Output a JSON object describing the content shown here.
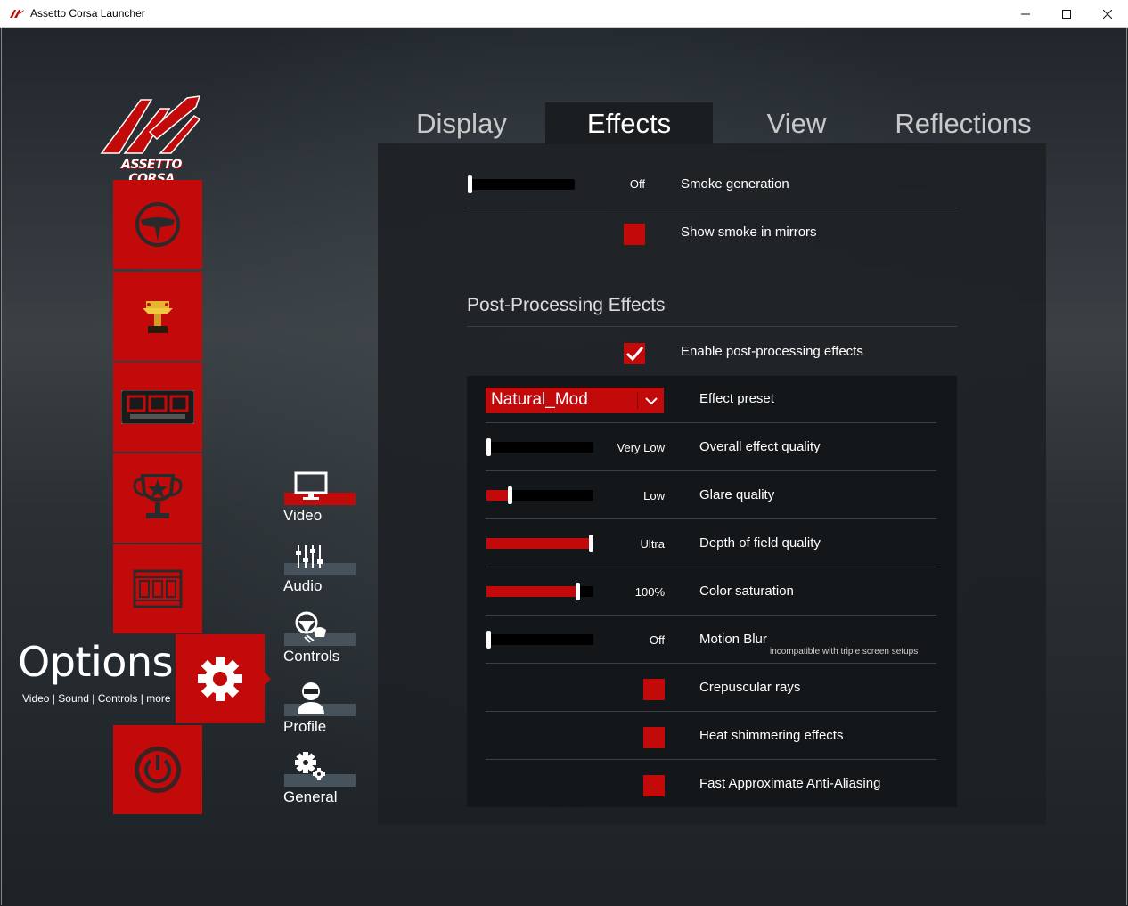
{
  "window": {
    "title": "Assetto Corsa Launcher",
    "minimize": "—",
    "maximize": "☐",
    "close": "✕"
  },
  "logo": {
    "text": "ASSETTO CORSA"
  },
  "main_menu": {
    "items": [
      "steering-wheel-icon",
      "trophy-car-icon",
      "srs-logo-icon",
      "championship-trophy-icon",
      "film-reel-icon",
      "gear-icon",
      "power-icon"
    ],
    "options_title": "Options",
    "options_subtitle": "Video | Sound | Controls | more"
  },
  "sub_menu": {
    "items": [
      {
        "label": "Video",
        "icon": "monitor-icon",
        "active": true
      },
      {
        "label": "Audio",
        "icon": "mixer-icon",
        "active": false
      },
      {
        "label": "Controls",
        "icon": "controls-icon",
        "active": false
      },
      {
        "label": "Profile",
        "icon": "driver-icon",
        "active": false
      },
      {
        "label": "General",
        "icon": "gears-icon",
        "active": false
      }
    ]
  },
  "tabs": [
    {
      "label": "Display",
      "active": false
    },
    {
      "label": "Effects",
      "active": true
    },
    {
      "label": "View",
      "active": false
    },
    {
      "label": "Reflections",
      "active": false
    }
  ],
  "effects": {
    "smoke_generation": {
      "label": "Smoke generation",
      "value": "Off",
      "level": 0.0
    },
    "smoke_in_mirrors": {
      "label": "Show smoke in mirrors",
      "checked": false
    },
    "post_processing_title": "Post-Processing Effects",
    "enable_post_processing": {
      "label": "Enable post-processing effects",
      "checked": true
    },
    "effect_preset": {
      "label": "Effect preset",
      "value": "Natural_Mod"
    },
    "overall_quality": {
      "label": "Overall effect quality",
      "value": "Very Low",
      "level": 0.0
    },
    "glare_quality": {
      "label": "Glare quality",
      "value": "Low",
      "level": 0.22
    },
    "dof_quality": {
      "label": "Depth of field quality",
      "value": "Ultra",
      "level": 1.0
    },
    "color_saturation": {
      "label": "Color saturation",
      "value": "100%",
      "level": 0.85
    },
    "motion_blur": {
      "label": "Motion Blur",
      "value": "Off",
      "level": 0.0,
      "note": "incompatible with triple screen setups"
    },
    "crepuscular_rays": {
      "label": "Crepuscular rays",
      "checked": false
    },
    "heat_shimmering": {
      "label": "Heat shimmering effects",
      "checked": false
    },
    "fxaa": {
      "label": "Fast Approximate Anti-Aliasing",
      "checked": false
    }
  },
  "colors": {
    "accent": "#c30a0a",
    "panel": "#1c2023",
    "text": "#ffffff"
  }
}
